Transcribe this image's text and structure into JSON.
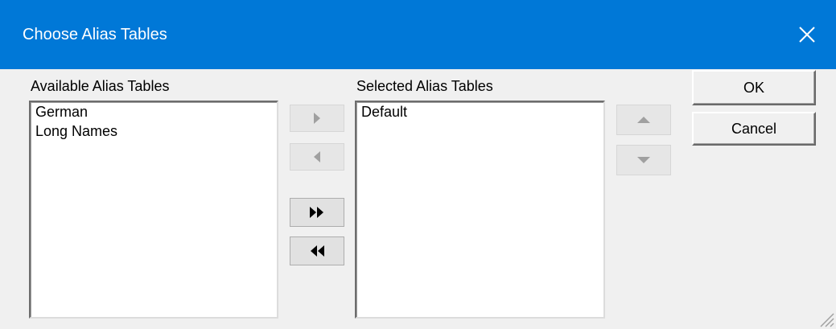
{
  "window": {
    "title": "Choose Alias Tables",
    "titlebar_color": "#0078d7"
  },
  "available": {
    "label": "Available Alias Tables",
    "items": [
      "German",
      "Long Names"
    ]
  },
  "selected": {
    "label": "Selected Alias Tables",
    "items": [
      "Default"
    ]
  },
  "buttons": {
    "ok": "OK",
    "cancel": "Cancel"
  },
  "icons": {
    "close": "close-icon",
    "add": "triangle-right-icon",
    "remove": "triangle-left-icon",
    "add_all": "double-triangle-right-icon",
    "remove_all": "double-triangle-left-icon",
    "move_up": "triangle-up-icon",
    "move_down": "triangle-down-icon",
    "grip": "resize-grip-icon"
  }
}
